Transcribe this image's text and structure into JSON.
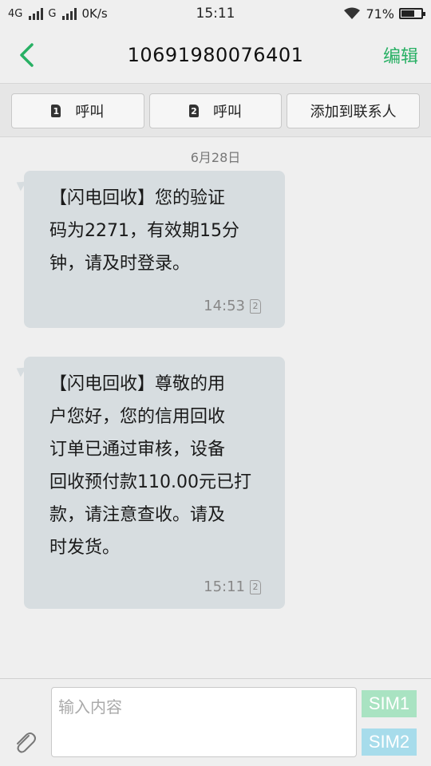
{
  "status_bar": {
    "network1": "4G",
    "network2": "G",
    "speed": "0K/s",
    "time": "15:11",
    "battery_percent": "71%",
    "battery_level": 0.71
  },
  "header": {
    "title": "10691980076401",
    "edit_label": "编辑",
    "accent_color": "#28b064"
  },
  "actions": {
    "call_sim1": {
      "sim": "1",
      "label": "呼叫"
    },
    "call_sim2": {
      "sim": "2",
      "label": "呼叫"
    },
    "add_contact": "添加到联系人"
  },
  "conversation": {
    "date": "6月28日",
    "messages": [
      {
        "text": "【闪电回收】您的验证\n码为2271，有效期15分\n钟，请及时登录。",
        "time": "14:53",
        "sim": "2"
      },
      {
        "text": "【闪电回收】尊敬的用\n户您好，您的信用回收\n订单已通过审核，设备\n回收预付款110.00元已打\n款，请注意查收。请及\n时发货。",
        "time": "15:11",
        "sim": "2"
      }
    ]
  },
  "composer": {
    "placeholder": "输入内容",
    "sim1_label": "SIM1",
    "sim2_label": "SIM2"
  }
}
